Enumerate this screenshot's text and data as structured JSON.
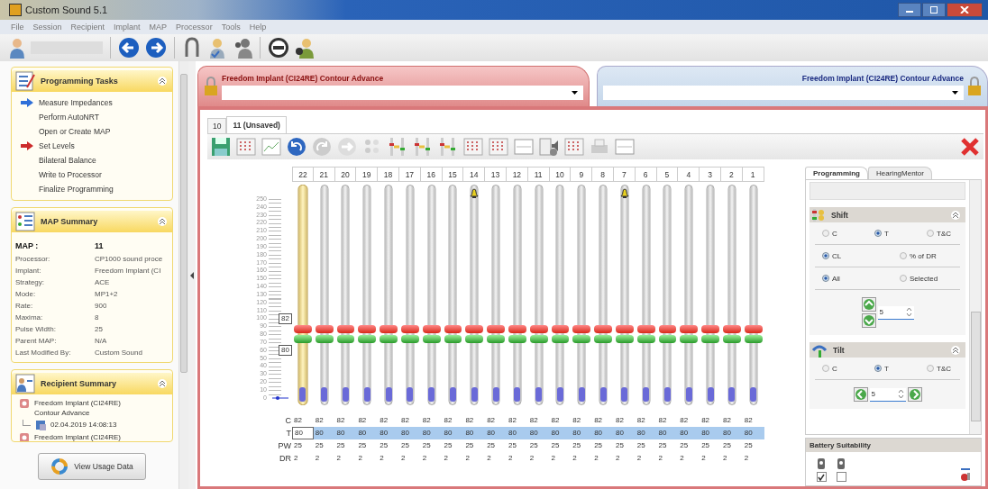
{
  "window": {
    "title": "Custom Sound 5.1"
  },
  "menu": [
    "File",
    "Session",
    "Recipient",
    "Implant",
    "MAP",
    "Processor",
    "Tools",
    "Help"
  ],
  "programming_tasks": {
    "title": "Programming Tasks",
    "items": [
      {
        "label": "Measure Impedances",
        "kind": "current"
      },
      {
        "label": "Perform AutoNRT",
        "kind": "plain"
      },
      {
        "label": "Open or Create MAP",
        "kind": "plain"
      },
      {
        "label": "Set Levels",
        "kind": "next"
      },
      {
        "label": "Bilateral Balance",
        "kind": "plain"
      },
      {
        "label": "Write to Processor",
        "kind": "plain"
      },
      {
        "label": "Finalize Programming",
        "kind": "plain"
      }
    ]
  },
  "map_summary": {
    "title": "MAP Summary",
    "rows": [
      {
        "label": "MAP :",
        "value": "11",
        "kind": "heading"
      },
      {
        "label": "Processor:",
        "value": "CP1000 sound proce",
        "kind": "plain"
      },
      {
        "label": "Implant:",
        "value": "Freedom Implant (CI",
        "kind": "plain"
      },
      {
        "label": "Strategy:",
        "value": "ACE",
        "kind": "plain"
      },
      {
        "label": "Mode:",
        "value": "MP1+2",
        "kind": "plain"
      },
      {
        "label": "Rate:",
        "value": "900",
        "kind": "plain"
      },
      {
        "label": "Maxima:",
        "value": "8",
        "kind": "plain"
      },
      {
        "label": "Pulse Width:",
        "value": "25",
        "kind": "plain"
      },
      {
        "label": "Parent MAP:",
        "value": "N/A",
        "kind": "plain"
      },
      {
        "label": "Last Modified By:",
        "value": "Custom Sound",
        "kind": "plain"
      }
    ]
  },
  "recipient_summary": {
    "title": "Recipient Summary",
    "items": [
      {
        "label": "Freedom Implant (CI24RE) Contour Advance",
        "children": [
          {
            "label": "02.04.2019 14:08:13"
          }
        ]
      },
      {
        "label": "Freedom Implant (CI24RE)"
      }
    ]
  },
  "usage_button": "View Usage Data",
  "implants": [
    {
      "title": "Freedom Implant (CI24RE) Contour Advance",
      "selected": true
    },
    {
      "title": "Freedom Implant (CI24RE) Contour Advance",
      "selected": false
    }
  ],
  "map_tabs": [
    {
      "label": "10",
      "selected": false
    },
    {
      "label": "11 (Unsaved)",
      "selected": true
    }
  ],
  "scale": [
    "250",
    "240",
    "230",
    "220",
    "210",
    "200",
    "190",
    "180",
    "170",
    "160",
    "150",
    "140",
    "130",
    "120",
    "110",
    "100",
    "90",
    "80",
    "70",
    "60",
    "50",
    "40",
    "30",
    "20",
    "10",
    "0"
  ],
  "callouts": [
    "82",
    "80"
  ],
  "table_rows": [
    {
      "label": "C",
      "selected": false
    },
    {
      "label": "T",
      "selected": true
    },
    {
      "label": "PW",
      "selected": false
    },
    {
      "label": "DR",
      "selected": false
    }
  ],
  "channels": [
    {
      "number": "22",
      "selected": true,
      "alarm": false,
      "values": [
        "82",
        "80",
        "25",
        "2"
      ]
    },
    {
      "number": "21",
      "selected": false,
      "alarm": false,
      "values": [
        "82",
        "80",
        "25",
        "2"
      ]
    },
    {
      "number": "20",
      "selected": false,
      "alarm": false,
      "values": [
        "82",
        "80",
        "25",
        "2"
      ]
    },
    {
      "number": "19",
      "selected": false,
      "alarm": false,
      "values": [
        "82",
        "80",
        "25",
        "2"
      ]
    },
    {
      "number": "18",
      "selected": false,
      "alarm": false,
      "values": [
        "82",
        "80",
        "25",
        "2"
      ]
    },
    {
      "number": "17",
      "selected": false,
      "alarm": false,
      "values": [
        "82",
        "80",
        "25",
        "2"
      ]
    },
    {
      "number": "16",
      "selected": false,
      "alarm": false,
      "values": [
        "82",
        "80",
        "25",
        "2"
      ]
    },
    {
      "number": "15",
      "selected": false,
      "alarm": false,
      "values": [
        "82",
        "80",
        "25",
        "2"
      ]
    },
    {
      "number": "14",
      "selected": false,
      "alarm": true,
      "values": [
        "82",
        "80",
        "25",
        "2"
      ]
    },
    {
      "number": "13",
      "selected": false,
      "alarm": false,
      "values": [
        "82",
        "80",
        "25",
        "2"
      ]
    },
    {
      "number": "12",
      "selected": false,
      "alarm": false,
      "values": [
        "82",
        "80",
        "25",
        "2"
      ]
    },
    {
      "number": "11",
      "selected": false,
      "alarm": false,
      "values": [
        "82",
        "80",
        "25",
        "2"
      ]
    },
    {
      "number": "10",
      "selected": false,
      "alarm": false,
      "values": [
        "82",
        "80",
        "25",
        "2"
      ]
    },
    {
      "number": "9",
      "selected": false,
      "alarm": false,
      "values": [
        "82",
        "80",
        "25",
        "2"
      ]
    },
    {
      "number": "8",
      "selected": false,
      "alarm": false,
      "values": [
        "82",
        "80",
        "25",
        "2"
      ]
    },
    {
      "number": "7",
      "selected": false,
      "alarm": true,
      "values": [
        "82",
        "80",
        "25",
        "2"
      ]
    },
    {
      "number": "6",
      "selected": false,
      "alarm": false,
      "values": [
        "82",
        "80",
        "25",
        "2"
      ]
    },
    {
      "number": "5",
      "selected": false,
      "alarm": false,
      "values": [
        "82",
        "80",
        "25",
        "2"
      ]
    },
    {
      "number": "4",
      "selected": false,
      "alarm": false,
      "values": [
        "82",
        "80",
        "25",
        "2"
      ]
    },
    {
      "number": "3",
      "selected": false,
      "alarm": false,
      "values": [
        "82",
        "80",
        "25",
        "2"
      ]
    },
    {
      "number": "2",
      "selected": false,
      "alarm": false,
      "values": [
        "82",
        "80",
        "25",
        "2"
      ]
    },
    {
      "number": "1",
      "selected": false,
      "alarm": false,
      "values": [
        "82",
        "80",
        "25",
        "2"
      ]
    }
  ],
  "side_tabs": [
    {
      "label": "Programming",
      "selected": true
    },
    {
      "label": "HearingMentor",
      "selected": false
    }
  ],
  "shift": {
    "title": "Shift",
    "groups": [
      [
        {
          "label": "C",
          "selected": false
        },
        {
          "label": "T",
          "selected": true
        },
        {
          "label": "T&C",
          "selected": false
        }
      ],
      [
        {
          "label": "CL",
          "selected": true
        },
        {
          "label": "% of DR",
          "selected": false
        }
      ],
      [
        {
          "label": "All",
          "selected": true
        },
        {
          "label": "Selected",
          "selected": false
        }
      ]
    ],
    "step": "5"
  },
  "tilt": {
    "title": "Tilt",
    "groups": [
      [
        {
          "label": "C",
          "selected": false
        },
        {
          "label": "T",
          "selected": true
        },
        {
          "label": "T&C",
          "selected": false
        }
      ]
    ],
    "step": "5"
  },
  "battery": {
    "title": "Battery Suitability",
    "options": [
      {
        "checked": true
      },
      {
        "checked": false
      }
    ]
  }
}
